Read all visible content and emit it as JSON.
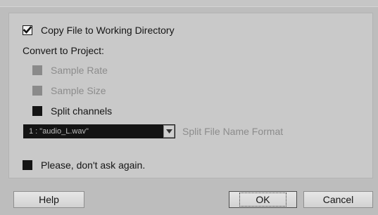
{
  "dialog": {
    "copy_file_label": "Copy File to Working Directory",
    "convert_heading": "Convert to Project:",
    "sample_rate_label": "Sample Rate",
    "sample_size_label": "Sample Size",
    "split_channels_label": "Split channels",
    "split_file_select_value": "1 : \"audio_L.wav\"",
    "split_file_name_format_label": "Split File Name Format",
    "dont_ask_label": "Please, don't ask again."
  },
  "buttons": {
    "help": "Help",
    "ok": "OK",
    "cancel": "Cancel"
  },
  "state": {
    "copy_file_checked": true,
    "sample_rate_enabled": false,
    "sample_size_enabled": false,
    "split_channels_checked": false,
    "dont_ask_checked": false
  },
  "colors": {
    "background": "#bdbdbd",
    "panel": "#c9c9c9",
    "checkbox": "#141414",
    "disabled_text": "#8c8c8c"
  },
  "icons": {
    "checkmark": "checkmark-icon",
    "dropdown": "chevron-down-icon"
  }
}
